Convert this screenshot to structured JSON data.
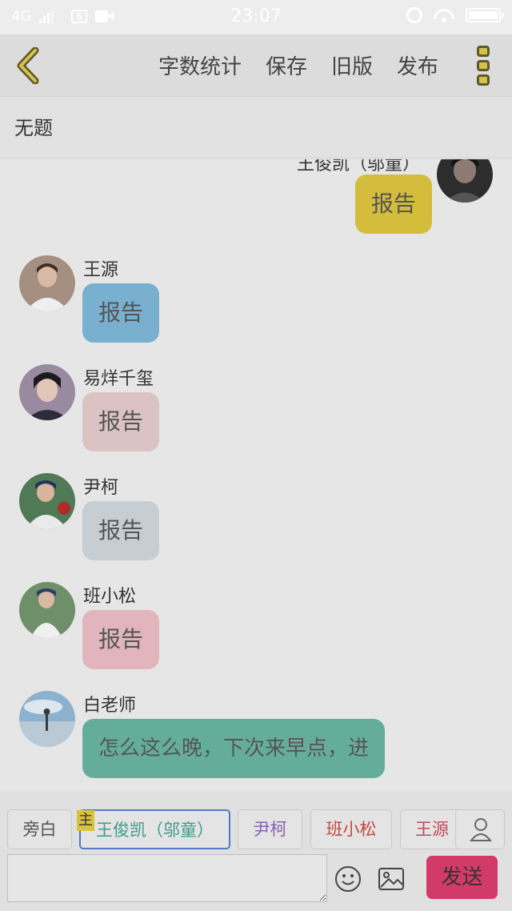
{
  "status_bar": {
    "network": "4G",
    "time": "23:07",
    "sim_badge": "S"
  },
  "header": {
    "actions": [
      "字数统计",
      "保存",
      "旧版",
      "发布"
    ]
  },
  "document": {
    "title": "无题"
  },
  "messages": [
    {
      "speaker": "王俊凯（邬童）",
      "text": "报告",
      "side": "right",
      "bubble_color": "#d4bd3c"
    },
    {
      "speaker": "王源",
      "text": "报告",
      "side": "left",
      "bubble_color": "#7ab0cf"
    },
    {
      "speaker": "易烊千玺",
      "text": "报告",
      "side": "left",
      "bubble_color": "#dcc3c3"
    },
    {
      "speaker": "尹柯",
      "text": "报告",
      "side": "left",
      "bubble_color": "#c6cdd3"
    },
    {
      "speaker": "班小松",
      "text": "报告",
      "side": "left",
      "bubble_color": "#e2b4bc"
    },
    {
      "speaker": "白老师",
      "text": "怎么这么晚，下次来早点，进",
      "side": "left",
      "bubble_color": "#65ad9b"
    }
  ],
  "roles": [
    {
      "label": "旁白",
      "color": "#555555"
    },
    {
      "label": "王俊凯（邬童）",
      "color": "#3a9c8c"
    },
    {
      "label": "尹柯",
      "color": "#8a5fb0"
    },
    {
      "label": "班小松",
      "color": "#c2493c"
    },
    {
      "label": "王源",
      "color": "#c44a5c"
    }
  ],
  "main_badge": "主",
  "composer": {
    "placeholder": "",
    "send_label": "发送"
  }
}
